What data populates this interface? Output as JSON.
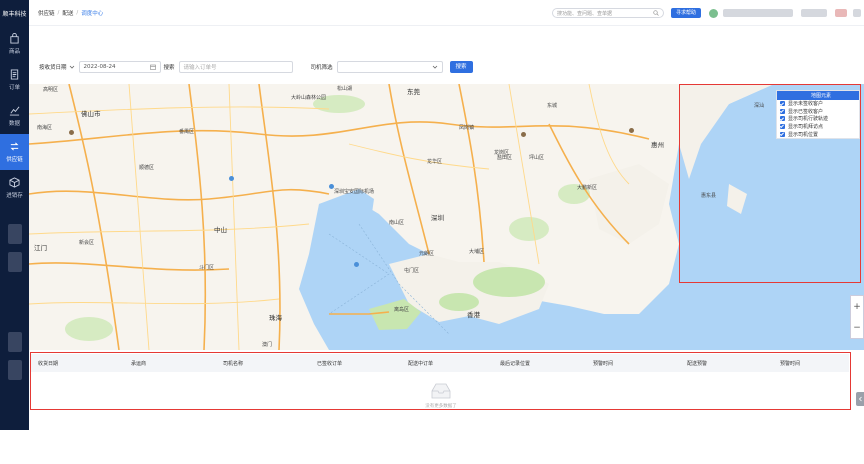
{
  "app": {
    "logo": "顺丰科技"
  },
  "sidebar": {
    "items": [
      {
        "label": "商品",
        "icon": "bag-icon"
      },
      {
        "label": "订单",
        "icon": "document-icon"
      },
      {
        "label": "数据",
        "icon": "chart-icon"
      },
      {
        "label": "供应链",
        "icon": "route-icon",
        "active": true
      },
      {
        "label": "进销存",
        "icon": "box-icon"
      }
    ]
  },
  "breadcrumb": {
    "items": [
      "供应链",
      "配送",
      "调度中心"
    ],
    "separator": "/"
  },
  "header": {
    "search_placeholder": "搜功能、查问题、查单据",
    "action_button": "寻求帮助"
  },
  "filters": {
    "date_type": "按收货日期",
    "date_value": "2022-08-24",
    "search_label": "搜索",
    "search_placeholder": "请输入订单号",
    "driver_label": "司机筛选",
    "driver_value": "",
    "search_button": "搜索"
  },
  "layer_panel": {
    "title": "地图元素",
    "items": [
      {
        "label": "显示未签收客户",
        "checked": true
      },
      {
        "label": "显示已签收客户",
        "checked": true
      },
      {
        "label": "显示司机行驶轨迹",
        "checked": true
      },
      {
        "label": "显示司机拜访点",
        "checked": true
      },
      {
        "label": "显示司机位置",
        "checked": true
      }
    ]
  },
  "map": {
    "labels": [
      {
        "text": "高明区"
      },
      {
        "text": "佛山市"
      },
      {
        "text": "南海区"
      },
      {
        "text": "大岭山森林公园"
      },
      {
        "text": "松山湖"
      },
      {
        "text": "东莞"
      },
      {
        "text": "凤岗镇"
      },
      {
        "text": "惠州"
      },
      {
        "text": "东城"
      },
      {
        "text": "龙岗区"
      },
      {
        "text": "坪山区"
      },
      {
        "text": "中山"
      },
      {
        "text": "深圳宝安国际机场"
      },
      {
        "text": "深圳"
      },
      {
        "text": "龙华区"
      },
      {
        "text": "南山区"
      },
      {
        "text": "盐田区"
      },
      {
        "text": "大鹏新区"
      },
      {
        "text": "元朗区"
      },
      {
        "text": "香港"
      },
      {
        "text": "珠海"
      },
      {
        "text": "澳门"
      },
      {
        "text": "屯门区"
      },
      {
        "text": "大埔区"
      },
      {
        "text": "离岛区"
      },
      {
        "text": "江门"
      },
      {
        "text": "新会区"
      },
      {
        "text": "斗门区"
      },
      {
        "text": "惠东县"
      },
      {
        "text": "深汕"
      },
      {
        "text": "番禺区"
      },
      {
        "text": "顺德区"
      }
    ],
    "zoom_in": "+",
    "zoom_out": "−"
  },
  "table": {
    "columns": [
      "收货日期",
      "承运商",
      "司机名称",
      "已签收订单",
      "配送中订单",
      "最后记录位置",
      "预警时间",
      "配送预警",
      "预警时间"
    ],
    "empty_text": "没有更多数据了"
  }
}
